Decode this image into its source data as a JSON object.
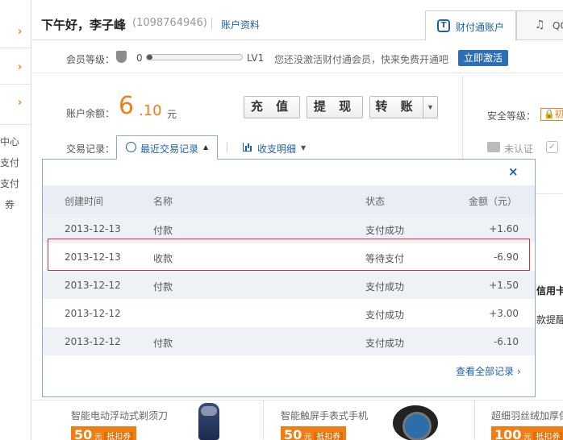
{
  "sidebar": {
    "items": [
      "中心",
      "支付",
      "支付",
      "券"
    ]
  },
  "header": {
    "greeting": "下午好，李子峰",
    "account_id": "(1098764946)",
    "profile_link": "账户资料",
    "tabs": [
      {
        "label": "财付通账户",
        "icon": "tenpay-icon",
        "active": true
      },
      {
        "label": "QQ",
        "icon": "qq-icon",
        "active": false
      }
    ]
  },
  "member": {
    "label": "会员等级：",
    "level_from": "0",
    "level_to": "LV1",
    "progress": 0.0,
    "hint": "您还没激活财付通会员，快来免费开通吧",
    "activate_label": "立即激活"
  },
  "balance": {
    "label": "账户余额：",
    "integer": "6",
    "decimal": ".10",
    "unit": "元",
    "actions": [
      "充 值",
      "提 现",
      "转 账"
    ]
  },
  "security": {
    "label": "安全等级：",
    "badge": "初",
    "auth_label": "未认证"
  },
  "records": {
    "label": "交易记录：",
    "recent_tab": "最近交易记录",
    "detail_tab": "收支明细",
    "columns": [
      "创建时间",
      "名称",
      "状态",
      "金额（元）"
    ],
    "rows": [
      {
        "date": "2013-12-13",
        "name": "付款",
        "status": "支付成功",
        "amount": "+1.60"
      },
      {
        "date": "2013-12-13",
        "name": "收款",
        "status": "等待支付",
        "amount": "-6.90"
      },
      {
        "date": "2013-12-12",
        "name": "付款",
        "status": "支付成功",
        "amount": "+1.50"
      },
      {
        "date": "2013-12-12",
        "name": "",
        "status": "支付成功",
        "amount": "+3.00"
      },
      {
        "date": "2013-12-12",
        "name": "付款",
        "status": "支付成功",
        "amount": "-6.10"
      }
    ],
    "highlighted_row": 1,
    "more_link": "查看全部记录 ›",
    "close_symbol": "×"
  },
  "right_partial": {
    "card_title": "信用卡",
    "card_sub": "款提醒"
  },
  "promos": [
    {
      "title": "智能电动浮动式剃须刀",
      "price": "50",
      "unit": "元",
      "coupon": "抵扣券"
    },
    {
      "title": "智能触屏手表式手机",
      "price": "50",
      "unit": "元",
      "coupon": "抵扣券"
    },
    {
      "title": "超细羽丝绒加厚保",
      "price": "100",
      "unit": "元",
      "coupon": "抵扣券"
    }
  ],
  "colors": {
    "accent_orange": "#f07e15",
    "link_blue": "#1f5fad",
    "highlight_red": "#d0303a"
  }
}
